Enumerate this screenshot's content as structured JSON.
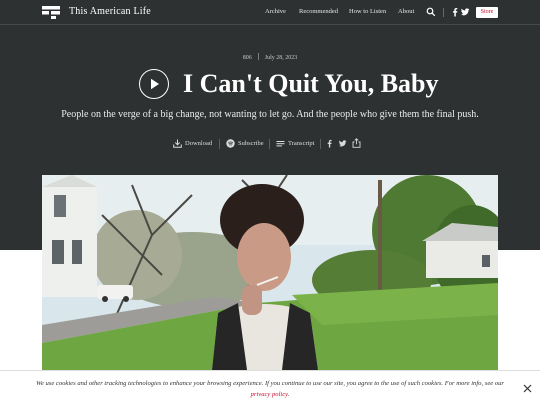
{
  "brand": {
    "name": "This American Life"
  },
  "nav": {
    "links": [
      "Archive",
      "Recommended",
      "How to Listen",
      "About"
    ],
    "store_label": "Store",
    "icons": [
      "search-icon",
      "facebook-icon",
      "twitter-icon"
    ]
  },
  "episode": {
    "number": "806",
    "date": "July 28, 2023",
    "title": "I Can't Quit You, Baby",
    "description": "People  on the verge of a big change, not wanting to let go. And the people who give them the final push."
  },
  "actions": {
    "download": "Download",
    "subscribe": "Subscribe",
    "transcript": "Transcript"
  },
  "cookie": {
    "text": "We use cookies and other tracking technologies to enhance your browsing experience. If you continue to use our site, you agree to the use of such cookies. For more info, see our",
    "link": "privacy policy",
    "tail": "."
  },
  "colors": {
    "header_background": "#2e3132",
    "accent": "#c8102e",
    "text_light": "#ffffff"
  }
}
